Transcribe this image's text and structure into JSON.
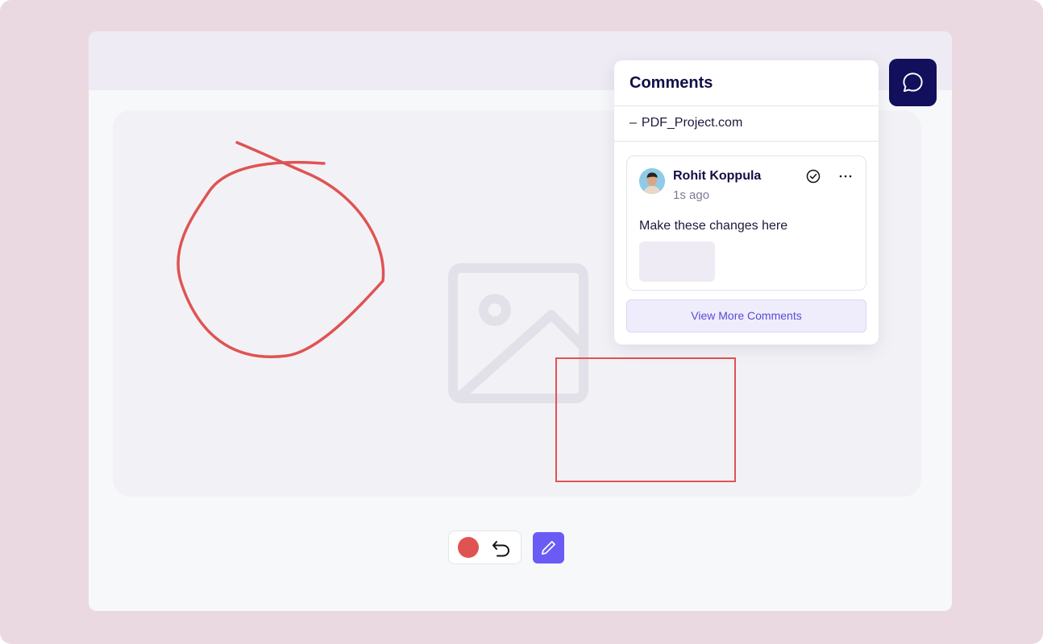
{
  "comments_panel": {
    "title": "Comments",
    "project": "PDF_Project.com",
    "project_prefix": "–",
    "comment": {
      "author": "Rohit Koppula",
      "time": "1s ago",
      "text": "Make these changes here"
    },
    "view_more_label": "View More Comments"
  },
  "toolbar": {
    "active_color": "#e05353",
    "pen_color": "#6b5bf5"
  },
  "icons": {
    "chat": "chat-bubble-icon",
    "undo": "undo-icon",
    "pen": "pencil-icon",
    "resolve": "check-circle-icon",
    "more": "more-horizontal-icon",
    "image": "image-placeholder-icon"
  },
  "colors": {
    "annotation": "#e05353",
    "brand_dark": "#120f5c",
    "accent": "#6b5bf5"
  }
}
